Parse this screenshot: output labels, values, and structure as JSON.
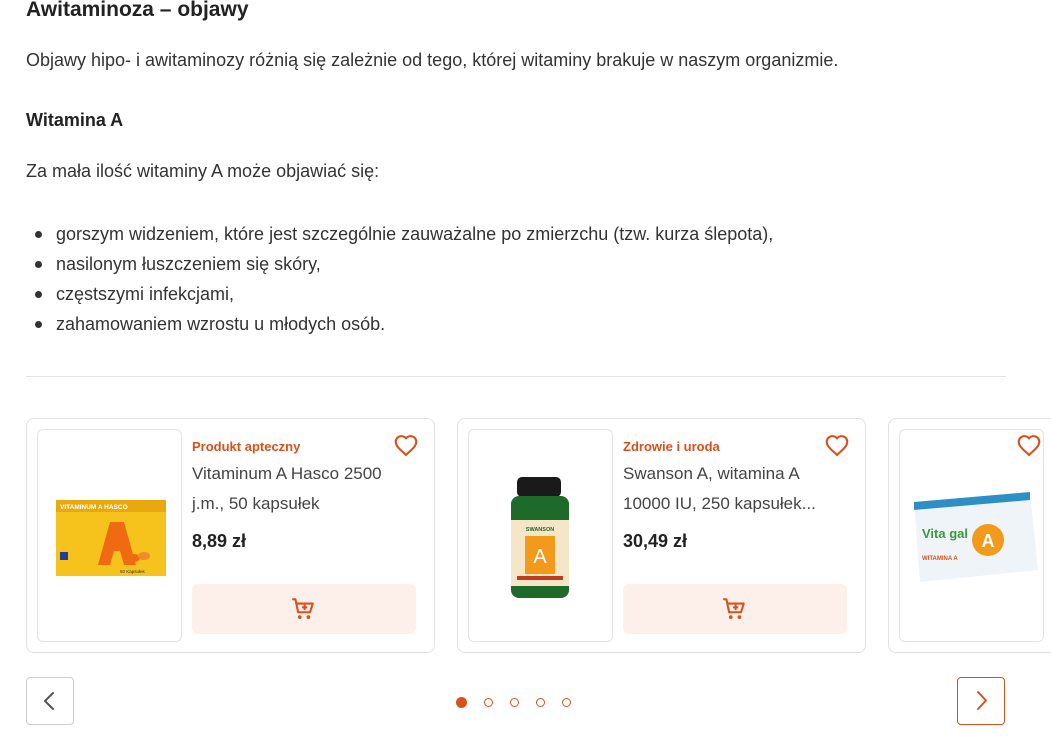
{
  "article": {
    "heading": "Awitaminoza – objawy",
    "intro": "Objawy hipo- i awitaminozy różnią się zależnie od tego, której witaminy brakuje w naszym organizmie.",
    "subheading": "Witamina A",
    "lead": "Za mała ilość witaminy A może objawiać się:",
    "symptoms": [
      "gorszym widzeniem, które jest szczególnie zauważalne po zmierzchu (tzw. kurza ślepota),",
      "nasilonym łuszczeniem się skóry,",
      "częstszymi infekcjami,",
      "zahamowaniem wzrostu u młodych osób."
    ]
  },
  "carousel": {
    "products": [
      {
        "category": "Produkt apteczny",
        "name_line1": "Vitaminum A Hasco 2500",
        "name_line2": "j.m., 50 kapsułek",
        "price": "8,89 zł",
        "packaging_text": "VITAMINUM A HASCO",
        "packaging_letter": "A",
        "packaging_count": "50 Kapsułek"
      },
      {
        "category": "Zdrowie i uroda",
        "name_line1": "Swanson A, witamina A",
        "name_line2": "10000 IU, 250 kapsułek...",
        "price": "30,49 zł",
        "packaging_brand": "SWANSON",
        "packaging_letter": "A"
      },
      {
        "packaging_text": "Vita gal",
        "packaging_letter": "A",
        "packaging_sub": "WITAMINA A"
      }
    ],
    "dots_total": 5,
    "active_dot": 0,
    "colors": {
      "accent": "#d9501a",
      "cart_bg": "#fdf0ea"
    },
    "icons": [
      "heart-icon",
      "cart-icon",
      "chevron-left-icon",
      "chevron-right-icon"
    ]
  }
}
